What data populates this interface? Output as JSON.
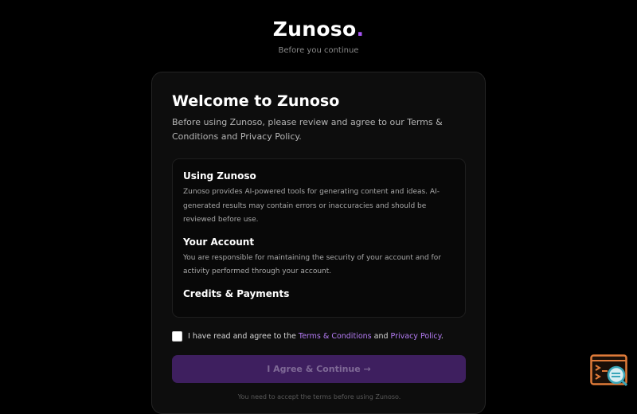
{
  "brand": {
    "name": "Zunoso",
    "dot": ".",
    "tagline": "Before you continue"
  },
  "card": {
    "title": "Welcome to Zunoso",
    "intro": "Before using Zunoso, please review and agree to our Terms & Conditions and Privacy Policy."
  },
  "terms": {
    "sections": [
      {
        "heading": "Using Zunoso",
        "text": "Zunoso provides AI-powered tools for generating content and ideas. AI-generated results may contain errors or inaccuracies and should be reviewed before use."
      },
      {
        "heading": "Your Account",
        "text": "You are responsible for maintaining the security of your account and for activity performed through your account."
      },
      {
        "heading": "Credits & Payments",
        "text": ""
      }
    ]
  },
  "agreement": {
    "prefix": "I have read and agree to the ",
    "terms_link": "Terms & Conditions",
    "middle": " and ",
    "privacy_link": "Privacy Policy",
    "suffix": ".",
    "checked": false
  },
  "cta": {
    "label": "I Agree & Continue →"
  },
  "hint": "You need to accept the terms before using Zunoso.",
  "colors": {
    "accent": "#a855f7",
    "link": "#b57cf5",
    "button_bg": "#3e1f5f",
    "button_text": "#7f6a96",
    "widget_orange": "#e07b39",
    "widget_teal": "#3aa6b9"
  },
  "icons": {
    "corner_widget": "terminal-search-icon"
  }
}
